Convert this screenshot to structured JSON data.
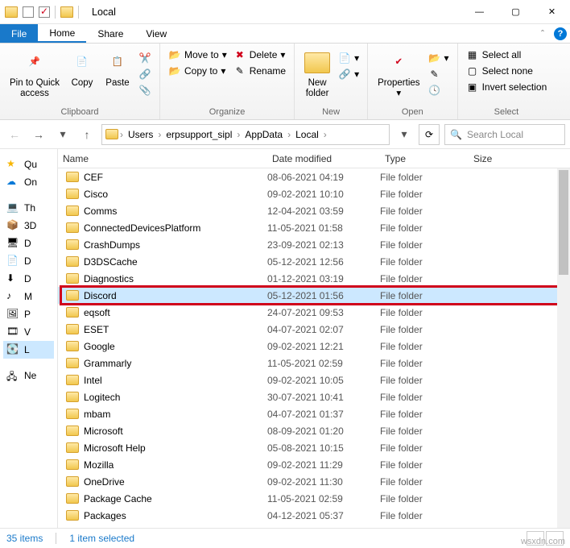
{
  "window": {
    "title": "Local"
  },
  "menutabs": {
    "file": "File",
    "home": "Home",
    "share": "Share",
    "view": "View"
  },
  "ribbon": {
    "clipboard": {
      "title": "Clipboard",
      "pin": "Pin to Quick\naccess",
      "copy": "Copy",
      "paste": "Paste"
    },
    "organize": {
      "title": "Organize",
      "moveto": "Move to",
      "copyto": "Copy to",
      "delete": "Delete",
      "rename": "Rename"
    },
    "new": {
      "title": "New",
      "newfolder": "New\nfolder"
    },
    "open": {
      "title": "Open",
      "properties": "Properties"
    },
    "select": {
      "title": "Select",
      "all": "Select all",
      "none": "Select none",
      "invert": "Invert selection"
    }
  },
  "breadcrumb": [
    "Users",
    "erpsupport_sipl",
    "AppData",
    "Local"
  ],
  "search": {
    "placeholder": "Search Local"
  },
  "nav": {
    "items": [
      {
        "label": "Qu",
        "icon": "star"
      },
      {
        "label": "On",
        "icon": "cloud"
      },
      {
        "label": "Th",
        "icon": "pc"
      },
      {
        "label": "3D",
        "icon": "cube"
      },
      {
        "label": "D",
        "icon": "desktop"
      },
      {
        "label": "D",
        "icon": "doc"
      },
      {
        "label": "D",
        "icon": "download"
      },
      {
        "label": "M",
        "icon": "music"
      },
      {
        "label": "P",
        "icon": "pic"
      },
      {
        "label": "V",
        "icon": "video"
      },
      {
        "label": "L",
        "icon": "disk",
        "selected": true
      },
      {
        "label": "Ne",
        "icon": "net"
      }
    ]
  },
  "columns": {
    "name": "Name",
    "date": "Date modified",
    "type": "Type",
    "size": "Size"
  },
  "rows": [
    {
      "name": "CEF",
      "date": "08-06-2021 04:19",
      "type": "File folder"
    },
    {
      "name": "Cisco",
      "date": "09-02-2021 10:10",
      "type": "File folder"
    },
    {
      "name": "Comms",
      "date": "12-04-2021 03:59",
      "type": "File folder"
    },
    {
      "name": "ConnectedDevicesPlatform",
      "date": "11-05-2021 01:58",
      "type": "File folder"
    },
    {
      "name": "CrashDumps",
      "date": "23-09-2021 02:13",
      "type": "File folder"
    },
    {
      "name": "D3DSCache",
      "date": "05-12-2021 12:56",
      "type": "File folder"
    },
    {
      "name": "Diagnostics",
      "date": "01-12-2021 03:19",
      "type": "File folder"
    },
    {
      "name": "Discord",
      "date": "05-12-2021 01:56",
      "type": "File folder",
      "selected": true,
      "highlighted": true
    },
    {
      "name": "eqsoft",
      "date": "24-07-2021 09:53",
      "type": "File folder"
    },
    {
      "name": "ESET",
      "date": "04-07-2021 02:07",
      "type": "File folder"
    },
    {
      "name": "Google",
      "date": "09-02-2021 12:21",
      "type": "File folder"
    },
    {
      "name": "Grammarly",
      "date": "11-05-2021 02:59",
      "type": "File folder"
    },
    {
      "name": "Intel",
      "date": "09-02-2021 10:05",
      "type": "File folder"
    },
    {
      "name": "Logitech",
      "date": "30-07-2021 10:41",
      "type": "File folder"
    },
    {
      "name": "mbam",
      "date": "04-07-2021 01:37",
      "type": "File folder"
    },
    {
      "name": "Microsoft",
      "date": "08-09-2021 01:20",
      "type": "File folder"
    },
    {
      "name": "Microsoft Help",
      "date": "05-08-2021 10:15",
      "type": "File folder"
    },
    {
      "name": "Mozilla",
      "date": "09-02-2021 11:29",
      "type": "File folder"
    },
    {
      "name": "OneDrive",
      "date": "09-02-2021 11:30",
      "type": "File folder"
    },
    {
      "name": "Package Cache",
      "date": "11-05-2021 02:59",
      "type": "File folder"
    },
    {
      "name": "Packages",
      "date": "04-12-2021 05:37",
      "type": "File folder"
    }
  ],
  "status": {
    "items": "35 items",
    "selected": "1 item selected"
  },
  "watermark": "wsxdn.com"
}
